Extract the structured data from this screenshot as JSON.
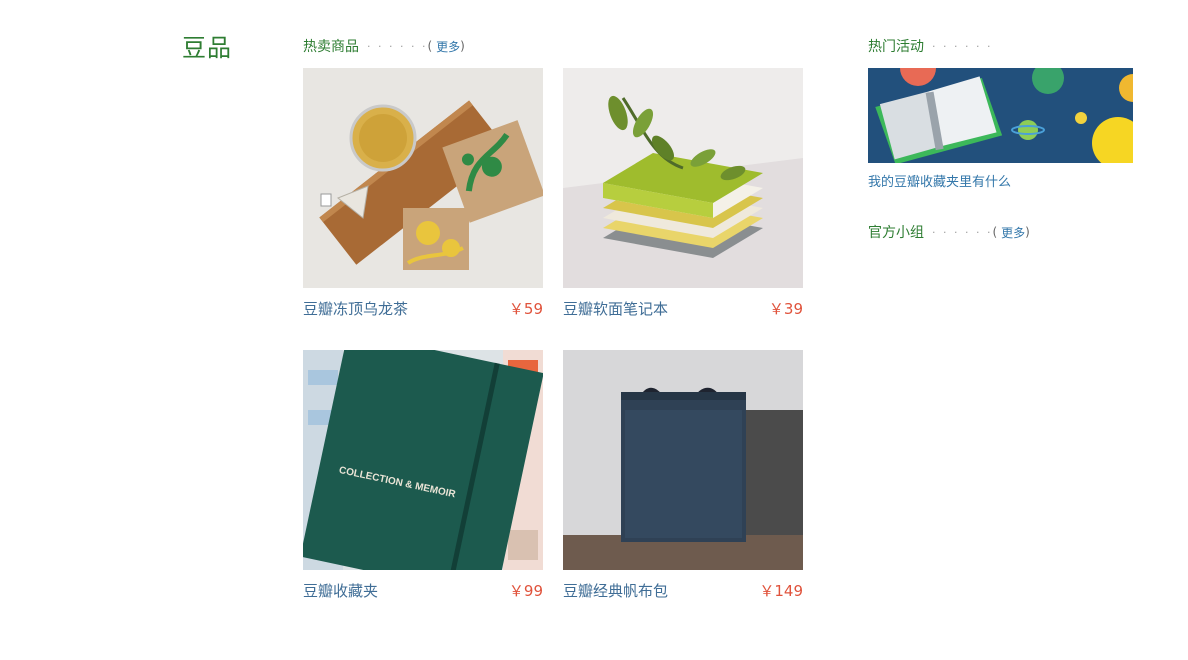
{
  "section": {
    "title": "豆品"
  },
  "hot": {
    "heading": "热卖商品",
    "dots": "· · · · · ·",
    "paren_open": "(",
    "more": "更多",
    "paren_close": ")"
  },
  "products": [
    {
      "name": "豆瓣冻顶乌龙茶",
      "price": "￥59"
    },
    {
      "name": "豆瓣软面笔记本",
      "price": "￥39"
    },
    {
      "name": "豆瓣收藏夹",
      "price": "￥99",
      "cover_text": "COLLECTION & MEMOIR"
    },
    {
      "name": "豆瓣经典帆布包",
      "price": "￥149"
    }
  ],
  "activities": {
    "heading": "热门活动",
    "dots": "· · · · · ·",
    "item": "我的豆瓣收藏夹里有什么"
  },
  "groups": {
    "heading": "官方小组",
    "dots": "· · · · · ·",
    "paren_open": "(",
    "more": "更多",
    "paren_close": ")"
  }
}
